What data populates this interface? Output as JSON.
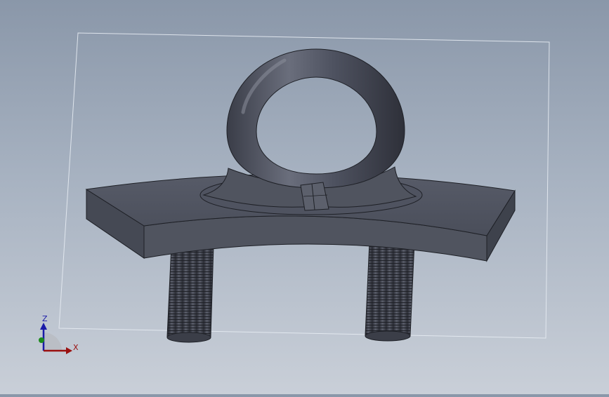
{
  "viewport": {
    "background_top": "#8a97a9",
    "background_bottom": "#c9cfd8",
    "model_color": "#4b4f5c"
  },
  "triad": {
    "z_label": "Z",
    "x_label": "X",
    "z_color": "#1a1aa8",
    "x_color": "#9a1010",
    "y_color": "#1c8a1c"
  },
  "model": {
    "parts": [
      "eye-ring",
      "curved-base-plate",
      "threaded-stud-left",
      "threaded-stud-right"
    ]
  }
}
